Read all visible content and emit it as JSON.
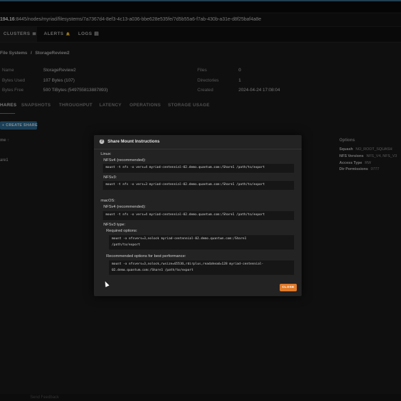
{
  "browser": {
    "url_host": "194.16",
    "url_rest": ":8445/nodes/myriad/filesystems/7a7367d4-8ef3-4c13-a036-bbe628e535fe/7d5b55a6-f7ab-430b-a31e-d8f25baf4a8e"
  },
  "nav": {
    "clusters_label": "CLUSTERS",
    "clusters_icon": "≣",
    "alerts_label": "ALERTS",
    "alerts_icon": "🔔",
    "logs_label": "LOGS",
    "logs_icon": "▤"
  },
  "breadcrumb": {
    "parent": "File Systems",
    "separator": "/",
    "current": "StorageReview2"
  },
  "details": {
    "name_label": "Name",
    "name_value": "StorageReview2",
    "bytes_used_label": "Bytes Used",
    "bytes_used_value": "107 Bytes (107)",
    "bytes_free_label": "Bytes Free",
    "bytes_free_value": "500 TiBytes (549755813887893)",
    "files_label": "Files",
    "files_value": "0",
    "directories_label": "Directories",
    "directories_value": "1",
    "created_label": "Created",
    "created_value": "2024-04-24 17:08:04"
  },
  "tabs": [
    "HARES",
    "SNAPSHOTS",
    "THROUGHPUT",
    "LATENCY",
    "OPERATIONS",
    "STORAGE USAGE"
  ],
  "create_share_label": "+ CREATE SHARE",
  "table": {
    "col_name": "me ↑",
    "col_options": "Options",
    "row_name": "are1",
    "options": [
      {
        "label": "Squash",
        "value": "NO_ROOT_SQUASH"
      },
      {
        "label": "NFS Versions",
        "value": "NFS_V4, NFS_V3"
      },
      {
        "label": "Access Type",
        "value": "RW"
      },
      {
        "label": "Dir Permissions",
        "value": "0777"
      }
    ]
  },
  "modal": {
    "title": "Share Mount Instructions",
    "title_icon": "?",
    "linux_label": "Linux:",
    "linux_nfsv4_label": "NFSv4 (recommended):",
    "linux_nfsv4_cmd": "mount -t nfs -o vers=4 myriad-centennial-02.demo.quantum.com:/Share1 /path/to/export",
    "linux_nfsv3_label": "NFSv3:",
    "linux_nfsv3_cmd": "mount -t nfs -o vers=3 myriad-centennial-02.demo.quantum.com:/Share1 /path/to/export",
    "macos_label": "macOS:",
    "macos_nfsv4_label": "NFSv4 (recommended):",
    "macos_nfsv4_cmd": "mount -t nfs -o vers=4 myriad-centennial-02.demo.quantum.com:/Share1 /path/to/export",
    "macos_nfsv3_label": "NFSv3 type:",
    "required_label": "Required options:",
    "required_cmd": "mount -o nfsvers=3,nolock myriad-centennial-02.demo.quantum.com:/Share1\n/path/to/export",
    "recommended_label": "Recommended options for best performance:",
    "recommended_cmd": "mount -o nfsvers=3,nolock,rwsize=65536,rdirplus,readahead=128 myriad-centennial-\n02.demo.quantum.com:/Share1 /path/to/export",
    "close_label": "CLOSE"
  },
  "footer_text": "Send Feedback",
  "colors": {
    "accent": "#2f6f96",
    "close_button": "#e07b2a",
    "modal_bg": "#232323"
  }
}
